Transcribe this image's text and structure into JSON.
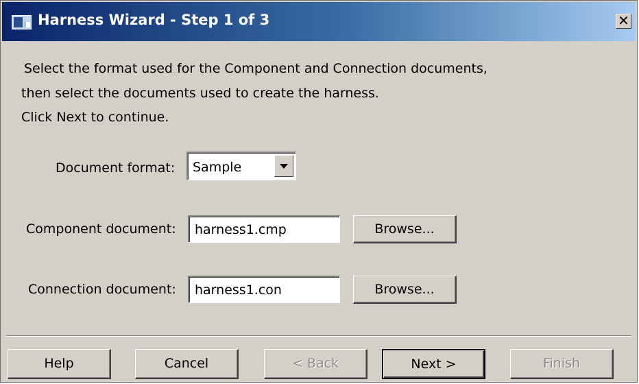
{
  "window": {
    "title": "Harness Wizard - Step 1 of 3",
    "close_glyph": "✕",
    "icon": "window-app-icon"
  },
  "instructions": {
    "line1": "Select the format used for the Component and Connection documents,",
    "line2": "then select the documents used to create the harness.",
    "line3": "Click Next to continue."
  },
  "form": {
    "format_label": "Document format:",
    "format_value": "Sample",
    "component_label": "Component document:",
    "component_value": "harness1.cmp",
    "connection_label": "Connection document:",
    "connection_value": "harness1.con",
    "browse_label": "Browse..."
  },
  "buttons": {
    "help": "Help",
    "cancel": "Cancel",
    "back": "< Back",
    "next": "Next >",
    "finish": "Finish"
  },
  "states": {
    "back_enabled": false,
    "finish_enabled": false,
    "next_default": true
  },
  "colors": {
    "dialog_background": "#d4d0c8",
    "title_bar_start": "#0a246a",
    "title_bar_end": "#a6caf0",
    "disabled_text": "#8c8c8c"
  }
}
